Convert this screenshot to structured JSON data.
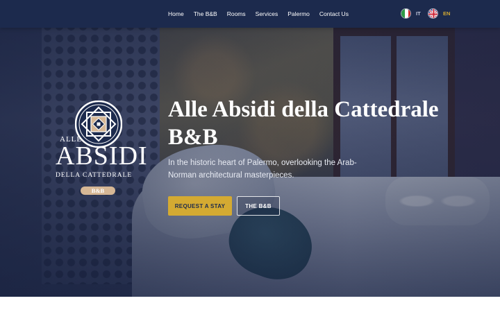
{
  "colors": {
    "navbar_bg": "#1c2a4d",
    "accent_gold": "#d4aa32",
    "lang_active": "#d4aa32",
    "lang_inactive": "#c5cbe0"
  },
  "nav": {
    "items": [
      {
        "label": "Home"
      },
      {
        "label": "The B&B"
      },
      {
        "label": "Rooms"
      },
      {
        "label": "Services"
      },
      {
        "label": "Palermo"
      },
      {
        "label": "Contact Us"
      }
    ]
  },
  "languages": {
    "it": {
      "code": "IT",
      "icon": "italy-flag-icon"
    },
    "en": {
      "code": "EN",
      "icon": "uk-flag-icon",
      "active": true
    }
  },
  "logo": {
    "line1": "ALLE",
    "line2": "ABSIDI",
    "line3": "DELLA CATTEDRALE",
    "badge": "B&B",
    "icon": "star-mosaic-icon"
  },
  "hero": {
    "title": "Alle Absidi della Cattedrale B&B",
    "subtitle": "In the historic heart of Palermo, overlooking the Arab-Norman architectural masterpieces.",
    "primary_button": "REQUEST A STAY",
    "secondary_button": "THE B&B"
  }
}
